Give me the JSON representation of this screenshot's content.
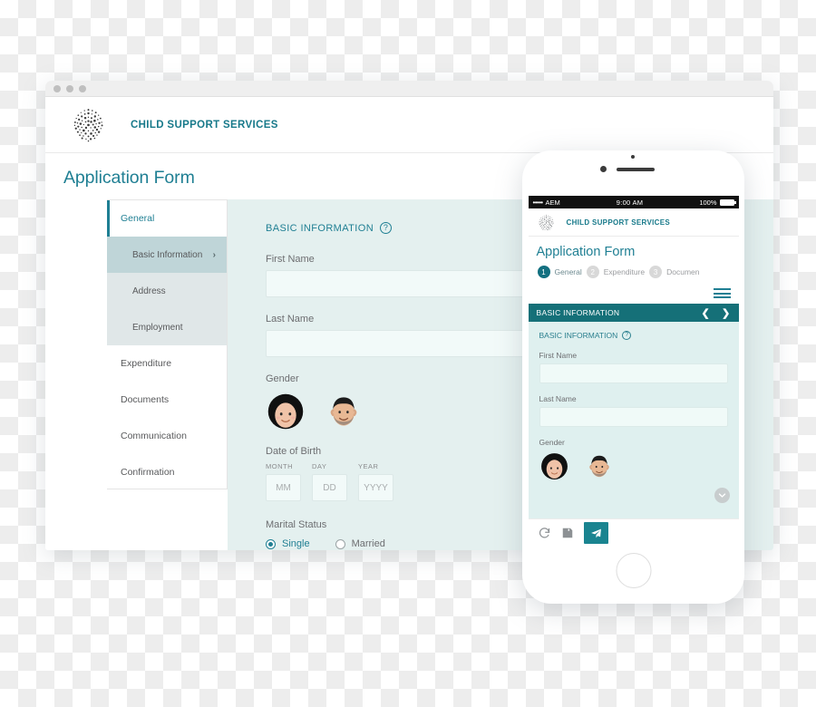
{
  "desktop": {
    "chrome": {
      "dots": [
        "window-close",
        "window-minimize",
        "window-zoom"
      ]
    },
    "header": {
      "logo_icon": "dotted-sphere-logo",
      "brand": "CHILD SUPPORT SERVICES"
    },
    "page_title": "Application Form",
    "sidebar": {
      "items": [
        {
          "label": "General",
          "type": "top",
          "state": "active"
        },
        {
          "label": "Basic Information",
          "type": "sub",
          "state": "selected",
          "chevron": "›"
        },
        {
          "label": "Address",
          "type": "sub",
          "state": "normal"
        },
        {
          "label": "Employment",
          "type": "sub",
          "state": "normal"
        },
        {
          "label": "Expenditure",
          "type": "top",
          "state": "normal"
        },
        {
          "label": "Documents",
          "type": "top",
          "state": "normal"
        },
        {
          "label": "Communication",
          "type": "top",
          "state": "normal"
        },
        {
          "label": "Confirmation",
          "type": "top",
          "state": "normal"
        }
      ]
    },
    "form": {
      "section_heading": "BASIC INFORMATION",
      "help_glyph": "?",
      "first_name_label": "First Name",
      "first_name_value": "",
      "last_name_label": "Last Name",
      "last_name_value": "",
      "gender_label": "Gender",
      "gender_options": [
        "female-avatar",
        "male-avatar"
      ],
      "dob_label": "Date of Birth",
      "dob": [
        {
          "caption": "MONTH",
          "placeholder": "MM",
          "value": ""
        },
        {
          "caption": "DAY",
          "placeholder": "DD",
          "value": ""
        },
        {
          "caption": "YEAR",
          "placeholder": "YYYY",
          "value": ""
        }
      ],
      "marital_label": "Marital Status",
      "marital_options": [
        {
          "label": "Single",
          "selected": true
        },
        {
          "label": "Married",
          "selected": false
        }
      ]
    }
  },
  "phone": {
    "status_bar": {
      "signal_dots": "•••••",
      "carrier": "AEM",
      "time": "9:00 AM",
      "battery_percent": "100%"
    },
    "header": {
      "logo_icon": "dotted-sphere-logo",
      "brand": "CHILD SUPPORT SERVICES"
    },
    "page_title": "Application Form",
    "steps": [
      {
        "num": "1",
        "label": "General",
        "active": true
      },
      {
        "num": "2",
        "label": "Expenditure",
        "active": false
      },
      {
        "num": "3",
        "label": "Documen",
        "active": false
      }
    ],
    "menu_icon": "hamburger-menu-icon",
    "section_bar": {
      "title": "BASIC INFORMATION",
      "prev_glyph": "❮",
      "next_glyph": "❯"
    },
    "form": {
      "section_heading": "BASIC INFORMATION",
      "help_glyph": "?",
      "first_name_label": "First Name",
      "first_name_value": "",
      "last_name_label": "Last Name",
      "last_name_value": "",
      "gender_label": "Gender",
      "scroll_chevron": "⌄"
    },
    "toolbar": {
      "refresh_icon": "refresh-icon",
      "save_icon": "save-floppy-icon",
      "send_icon": "send-paper-plane-icon"
    },
    "home_button": "home-button"
  },
  "colors": {
    "teal_brand": "#17798a",
    "teal_title": "#1f7f93",
    "teal_bar": "#157078",
    "teal_send": "#1a8490",
    "form_bg": "#e4f0ef",
    "phone_form_bg": "#dff0ef",
    "sidebar_sub_bg": "#e0e7e8",
    "sidebar_selected_bg": "#bfd5d8"
  }
}
